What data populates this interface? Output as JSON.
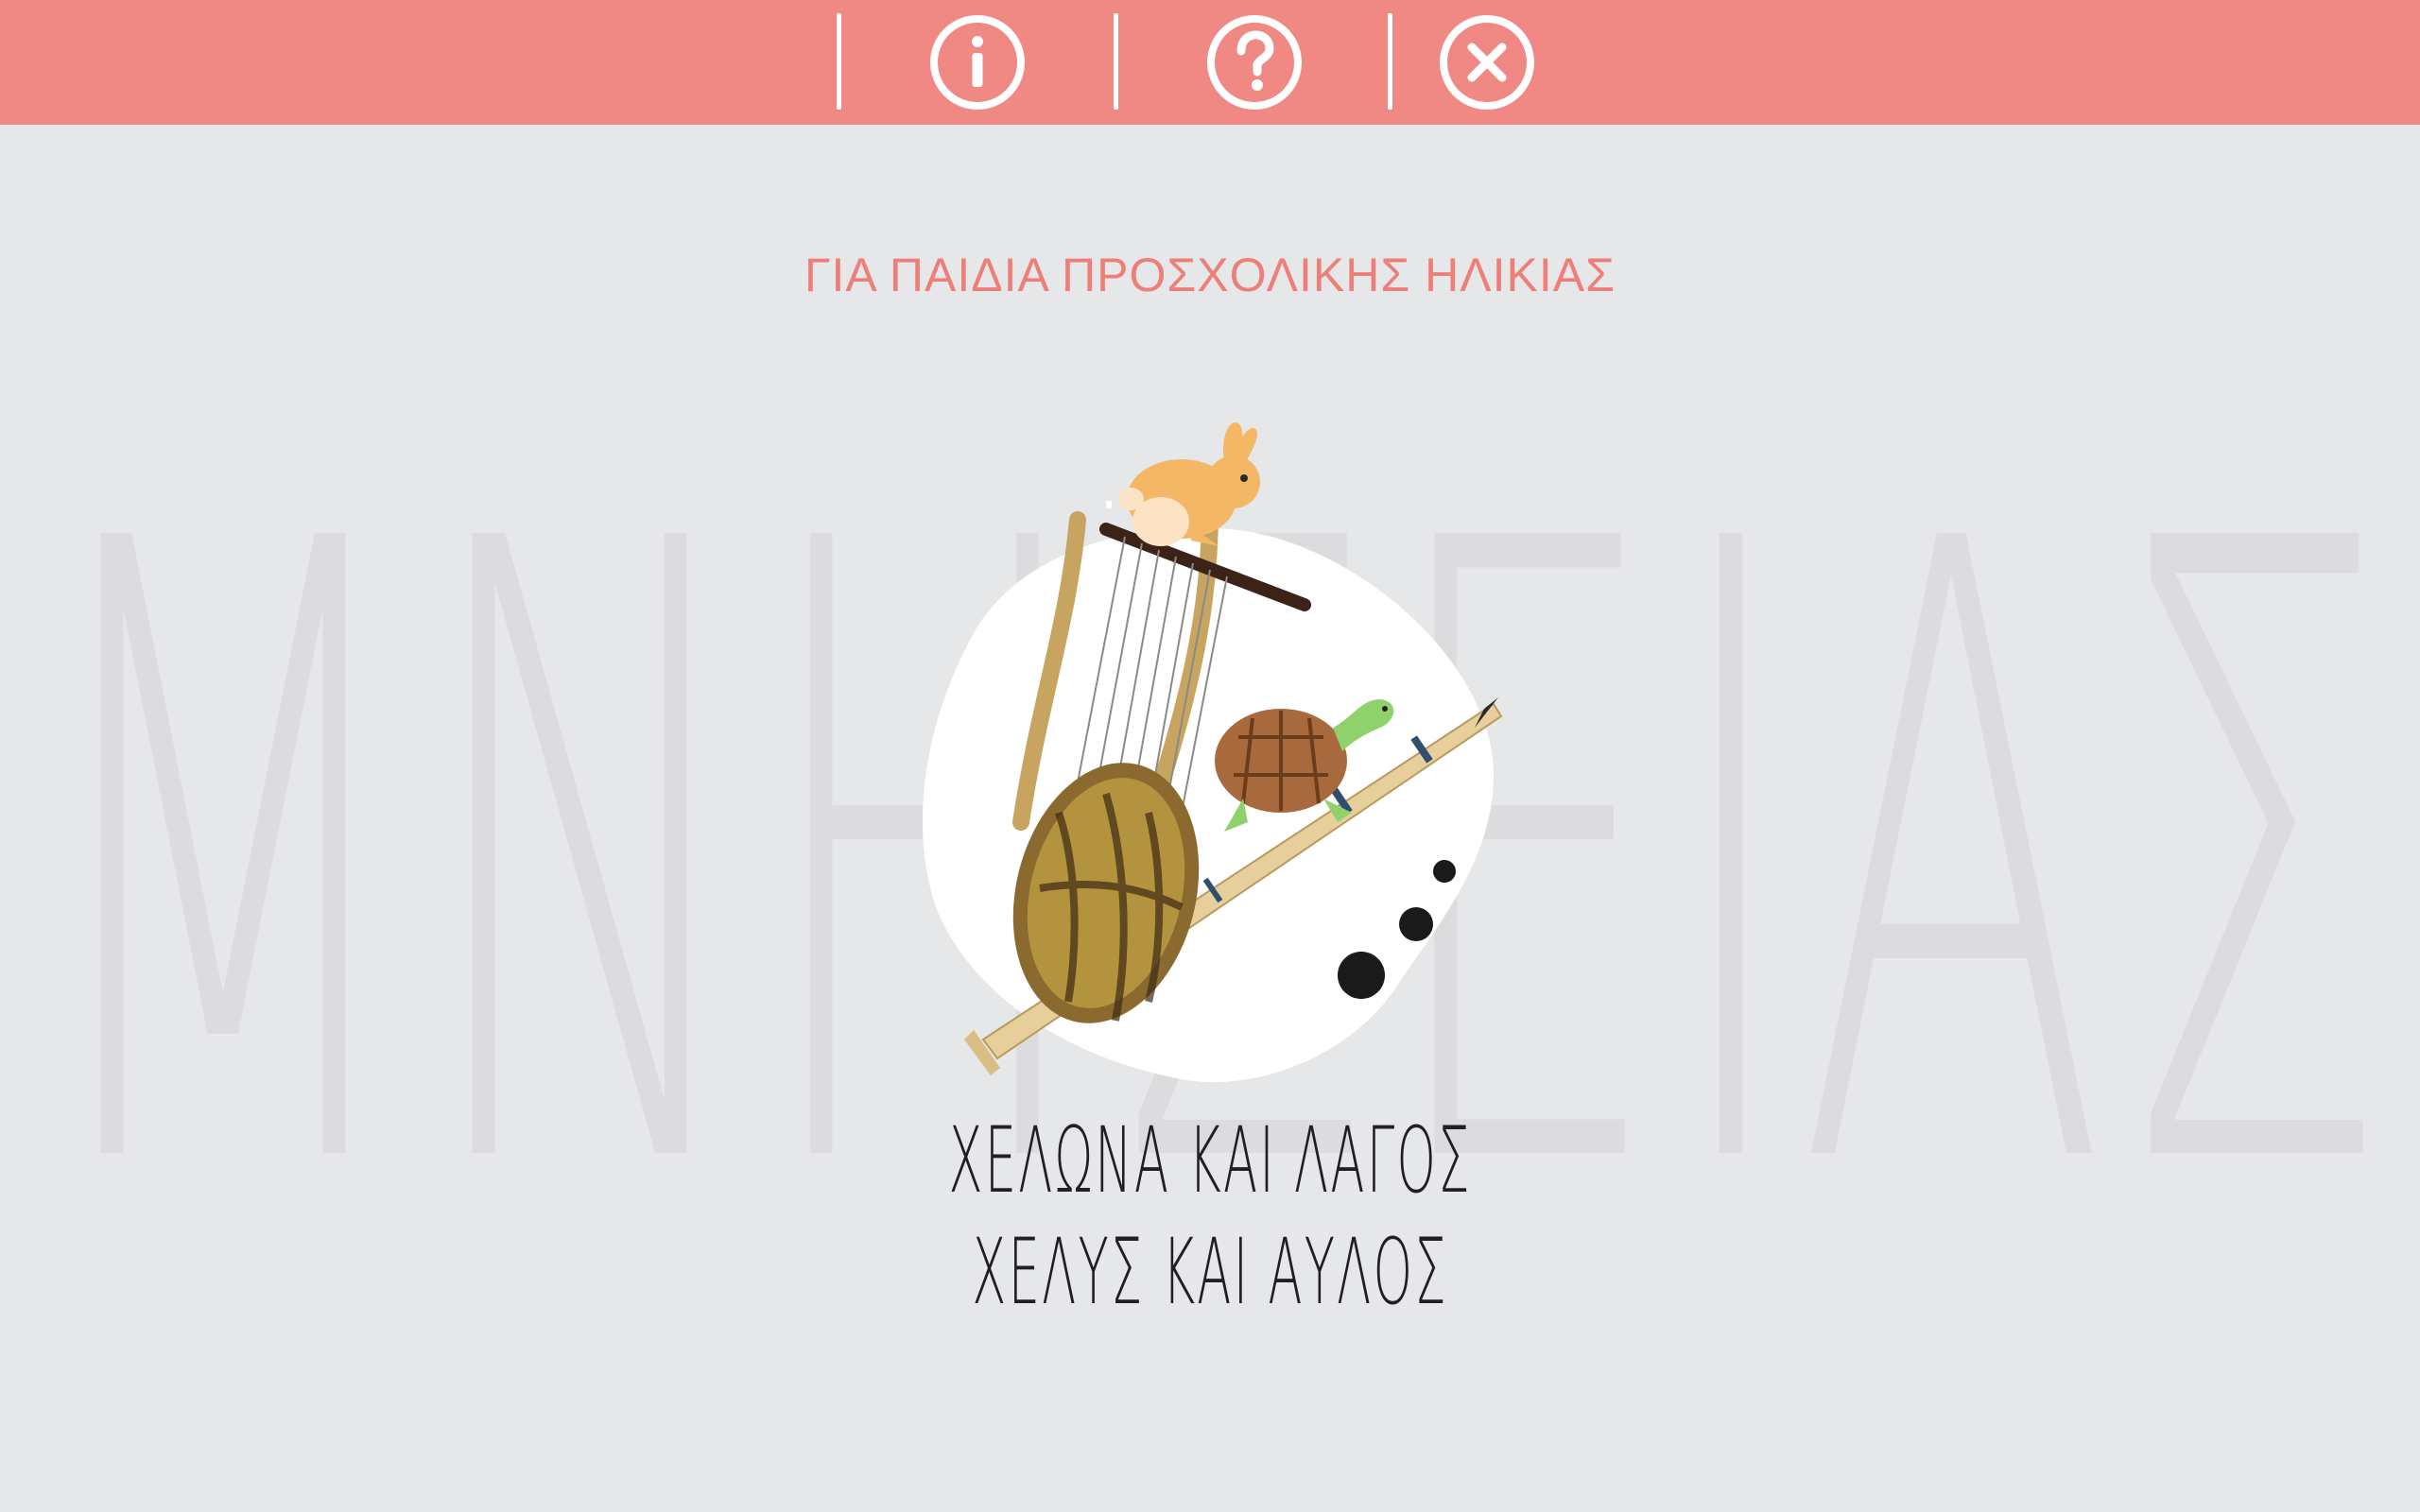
{
  "toolbar": {
    "buttons": [
      {
        "name": "info",
        "icon": "info-icon"
      },
      {
        "name": "help",
        "icon": "question-icon"
      },
      {
        "name": "close",
        "icon": "close-icon"
      }
    ],
    "background_color": "#f08883",
    "icon_color": "#ffffff"
  },
  "watermark": {
    "text": "ΜΝΗΣΕΙΑΣ",
    "color": "#dcdcde"
  },
  "main": {
    "subtitle": "ΓΙΑ ΠΑΙΔΙΑ ΠΡΟΣΧΟΛΙΚΗΣ ΗΛΙΚΙΑΣ",
    "title_line_1": "ΧΕΛΩΝΑ ΚΑΙ ΛΑΓΟΣ",
    "title_line_2": "ΧΕΛΥΣ ΚΑΙ ΑΥΛΟΣ",
    "subtitle_color": "#ee7f78",
    "illustration": [
      "hare",
      "tortoise",
      "lyre",
      "aulos"
    ]
  }
}
